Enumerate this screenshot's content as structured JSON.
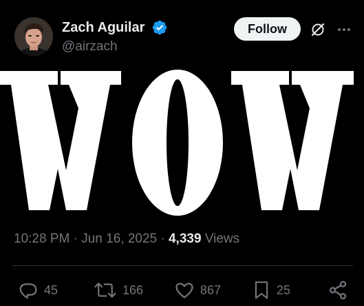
{
  "author": {
    "display_name": "Zach Aguilar",
    "handle": "@airzach",
    "verified": true,
    "verified_color": "#1d9bf0"
  },
  "header": {
    "follow_label": "Follow",
    "icons": [
      "grok-icon",
      "more-icon"
    ]
  },
  "post": {
    "image_text": "WOW",
    "time": "10:28 PM",
    "date": "Jun 16, 2025",
    "separator": "·",
    "views_count": "4,339",
    "views_label": "Views"
  },
  "actions": {
    "replies": "45",
    "reposts": "166",
    "likes": "867",
    "bookmarks": "25"
  },
  "colors": {
    "background": "#000000",
    "primary_text": "#e7e9ea",
    "secondary_text": "#71767b",
    "divider": "#2f3336",
    "follow_button_bg": "#eff3f4"
  }
}
